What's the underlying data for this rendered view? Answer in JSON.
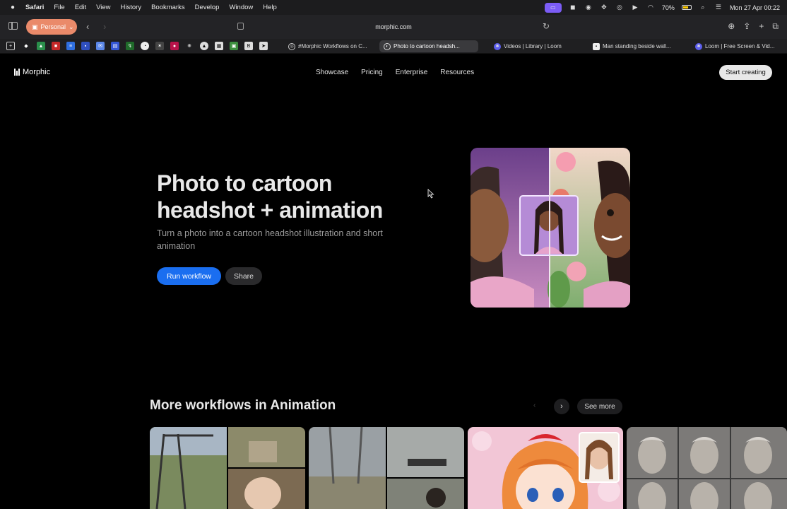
{
  "menubar": {
    "app": "Safari",
    "items": [
      "File",
      "Edit",
      "View",
      "History",
      "Bookmarks",
      "Develop",
      "Window",
      "Help"
    ],
    "battery": "70%",
    "battery_level": 0.7,
    "datetime": "Mon 27 Apr  00:22"
  },
  "toolbar": {
    "profile": "Personal",
    "url": "morphic.com"
  },
  "tabs": [
    {
      "label": "#Morphic Workflows on C..."
    },
    {
      "label": "Photo to cartoon headsh..."
    },
    {
      "label": "Videos | Library | Loom"
    },
    {
      "label": "Man standing beside wall..."
    },
    {
      "label": "Loom | Free Screen & Vid..."
    }
  ],
  "site": {
    "logo": "Morphic",
    "nav": [
      "Showcase",
      "Pricing",
      "Enterprise",
      "Resources"
    ],
    "cta": "Start creating"
  },
  "hero": {
    "title_line1": "Photo to cartoon",
    "title_line2": "headshot + animation",
    "subtitle": "Turn a photo into a cartoon headshot illustration and short animation",
    "run_button": "Run workflow",
    "share_button": "Share"
  },
  "more": {
    "title": "More workflows in Animation",
    "see_more": "See more"
  },
  "colors": {
    "accent_blue": "#1a6ef0",
    "profile_orange": "#ea8a6a",
    "status_purple": "#7b5cf5"
  }
}
